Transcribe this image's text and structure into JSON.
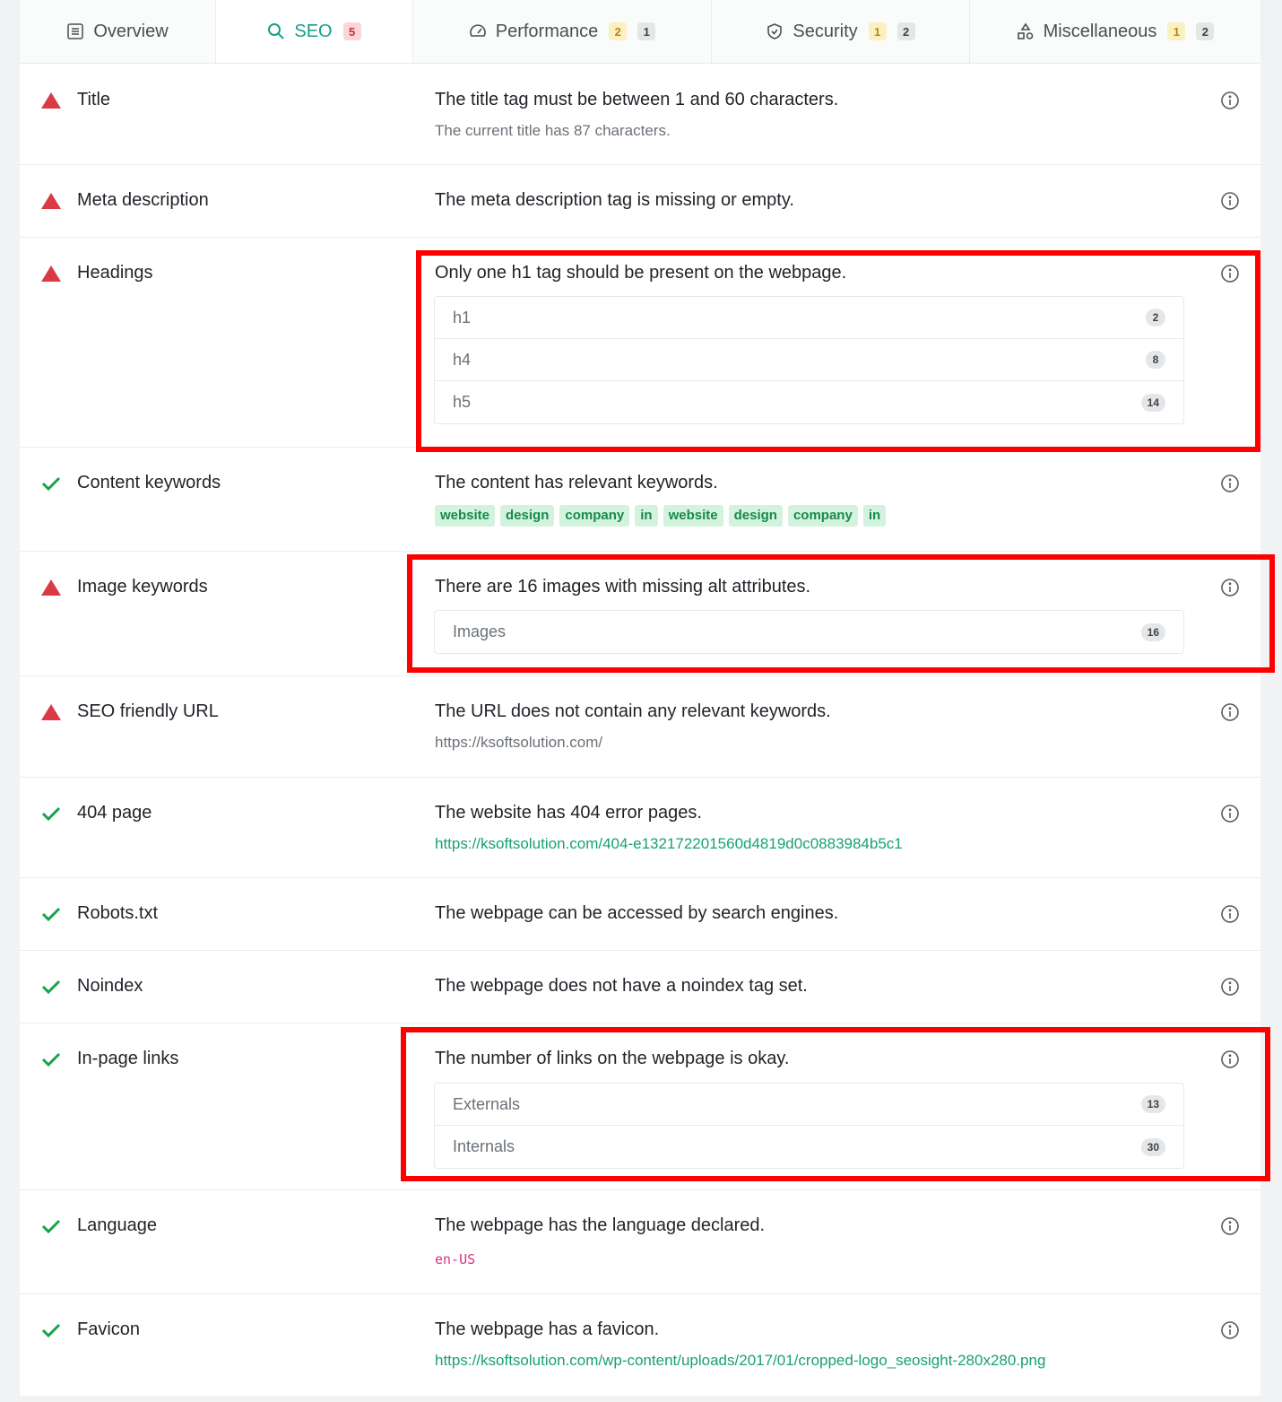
{
  "tabs": [
    {
      "label": "Overview",
      "icon": "list-icon",
      "badges": []
    },
    {
      "label": "SEO",
      "icon": "search-icon",
      "badges": [
        {
          "value": "5",
          "kind": "red"
        }
      ]
    },
    {
      "label": "Performance",
      "icon": "gauge-icon",
      "badges": [
        {
          "value": "2",
          "kind": "yellow"
        },
        {
          "value": "1",
          "kind": "gray"
        }
      ]
    },
    {
      "label": "Security",
      "icon": "shield-icon",
      "badges": [
        {
          "value": "1",
          "kind": "yellow"
        },
        {
          "value": "2",
          "kind": "gray"
        }
      ]
    },
    {
      "label": "Miscellaneous",
      "icon": "shapes-icon",
      "badges": [
        {
          "value": "1",
          "kind": "yellow"
        },
        {
          "value": "2",
          "kind": "gray"
        }
      ]
    }
  ],
  "colors": {
    "accent": "#16a085",
    "error": "#d93a46",
    "pass": "#16a34a",
    "highlight": "#ff0000"
  },
  "rows": {
    "title": {
      "label": "Title",
      "status": "fail",
      "message": "The title tag must be between 1 and 60 characters.",
      "detail": "The current title has 87 characters."
    },
    "meta": {
      "label": "Meta description",
      "status": "fail",
      "message": "The meta description tag is missing or empty."
    },
    "headings": {
      "label": "Headings",
      "status": "fail",
      "message": "Only one h1 tag should be present on the webpage.",
      "items": [
        {
          "name": "h1",
          "count": "2"
        },
        {
          "name": "h4",
          "count": "8"
        },
        {
          "name": "h5",
          "count": "14"
        }
      ]
    },
    "content_keywords": {
      "label": "Content keywords",
      "status": "pass",
      "message": "The content has relevant keywords.",
      "tags": [
        "website",
        "design",
        "company",
        "in",
        "website",
        "design",
        "company",
        "in"
      ]
    },
    "image_keywords": {
      "label": "Image keywords",
      "status": "fail",
      "message": "There are 16 images with missing alt attributes.",
      "items": [
        {
          "name": "Images",
          "count": "16"
        }
      ]
    },
    "seo_url": {
      "label": "SEO friendly URL",
      "status": "fail",
      "message": "The URL does not contain any relevant keywords.",
      "detail": "https://ksoftsolution.com/"
    },
    "page404": {
      "label": "404 page",
      "status": "pass",
      "message": "The website has 404 error pages.",
      "link": "https://ksoftsolution.com/404-e132172201560d4819d0c0883984b5c1"
    },
    "robots": {
      "label": "Robots.txt",
      "status": "pass",
      "message": "The webpage can be accessed by search engines."
    },
    "noindex": {
      "label": "Noindex",
      "status": "pass",
      "message": "The webpage does not have a noindex tag set."
    },
    "links": {
      "label": "In-page links",
      "status": "pass",
      "message": "The number of links on the webpage is okay.",
      "items": [
        {
          "name": "Externals",
          "count": "13"
        },
        {
          "name": "Internals",
          "count": "30"
        }
      ]
    },
    "language": {
      "label": "Language",
      "status": "pass",
      "message": "The webpage has the language declared.",
      "code": "en-US"
    },
    "favicon": {
      "label": "Favicon",
      "status": "pass",
      "message": "The webpage has a favicon.",
      "link": "https://ksoftsolution.com/wp-content/uploads/2017/01/cropped-logo_seosight-280x280.png"
    }
  }
}
